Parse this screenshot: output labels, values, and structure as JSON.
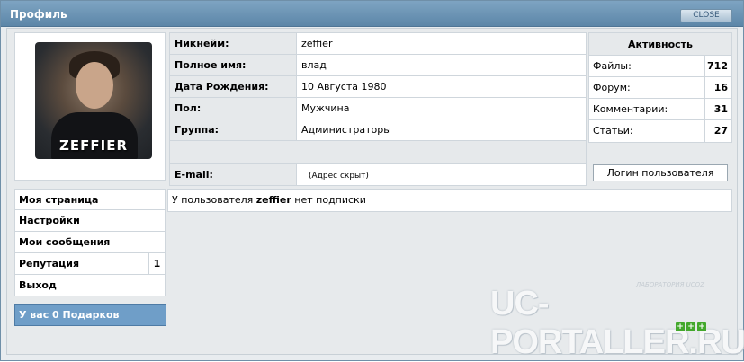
{
  "window": {
    "title": "Профиль",
    "close_label": "CLOSE"
  },
  "avatar": {
    "caption": "ZEFFIER"
  },
  "info": {
    "rows": [
      {
        "label": "Никнейм:",
        "value": "zeffier"
      },
      {
        "label": "Полное имя:",
        "value": "влад"
      },
      {
        "label": "Дата Рождения:",
        "value": "10 Августа 1980"
      },
      {
        "label": "Пол:",
        "value": "Мужчина"
      },
      {
        "label": "Группа:",
        "value": "Администраторы"
      }
    ],
    "email": {
      "label": "E-mail:",
      "value": "(Адрес скрыт)"
    }
  },
  "activity": {
    "title": "Активность",
    "rows": [
      {
        "label": "Файлы:",
        "value": "712"
      },
      {
        "label": "Форум:",
        "value": "16"
      },
      {
        "label": "Комментарии:",
        "value": "31"
      },
      {
        "label": "Статьи:",
        "value": "27"
      }
    ]
  },
  "login_button": "Логин пользователя",
  "menu": {
    "items": [
      {
        "label": "Моя страница"
      },
      {
        "label": "Настройки"
      },
      {
        "label": "Мои сообщения"
      },
      {
        "label": "Репутация",
        "count": "1"
      },
      {
        "label": "Выход"
      }
    ],
    "gifts": "У вас 0 Подарков"
  },
  "subscriptions": {
    "prefix": "У пользователя ",
    "user": "zeffier",
    "suffix": " нет подписки"
  },
  "watermark": {
    "main": "UC-PORTALLER.RU",
    "sub": "ЛАБОРАТОРИЯ UCOZ",
    "plus": "+"
  },
  "colors": {
    "titlebar": "#6a92b4",
    "gifts": "#6f9ec8",
    "plus": "#43a82c"
  }
}
